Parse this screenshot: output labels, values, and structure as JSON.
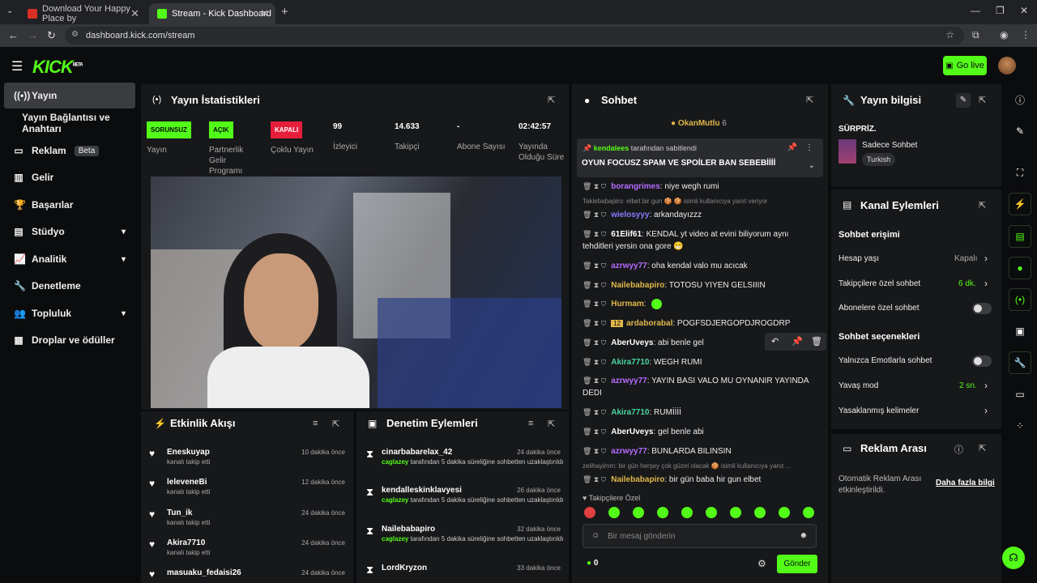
{
  "browser": {
    "tabs": [
      {
        "title": "Download Your Happy Place by"
      },
      {
        "title": "Stream - Kick Dashboard"
      }
    ],
    "url": "dashboard.kick.com/stream"
  },
  "header": {
    "logo": "KICK",
    "logo_sup": "BETA",
    "go_live": "Go live"
  },
  "sidebar": {
    "items": [
      {
        "label": "Yayın"
      },
      {
        "label": "Yayın Bağlantısı ve Anahtarı"
      },
      {
        "label": "Reklam",
        "badge": "Beta"
      },
      {
        "label": "Gelir"
      },
      {
        "label": "Başarılar"
      },
      {
        "label": "Stüdyo"
      },
      {
        "label": "Analitik"
      },
      {
        "label": "Denetleme"
      },
      {
        "label": "Topluluk"
      },
      {
        "label": "Droplar ve ödüller"
      }
    ]
  },
  "stats": {
    "title": "Yayın İstatistikleri",
    "items": [
      {
        "badge": "SORUNSUZ",
        "label": "Yayın"
      },
      {
        "badge": "AÇIK",
        "label": "Partnerlik Gelir Programı"
      },
      {
        "badge": "KAPALI",
        "label": "Çoklu Yayın"
      },
      {
        "value": "99",
        "label": "İzleyici"
      },
      {
        "value": "14.633",
        "label": "Takipçi"
      },
      {
        "value": "-",
        "label": "Abone Sayısı"
      },
      {
        "value": "02:42:57",
        "label": "Yayında Olduğu Süre"
      }
    ]
  },
  "activity": {
    "title": "Etkinlik Akışı",
    "items": [
      {
        "name": "Eneskuyap",
        "sub": "kanalı takip etti",
        "time": "10 dakika önce"
      },
      {
        "name": "leleveneBi",
        "sub": "kanalı takip etti",
        "time": "12 dakika önce"
      },
      {
        "name": "Tun_ik",
        "sub": "kanalı takip etti",
        "time": "24 dakika önce"
      },
      {
        "name": "Akira7710",
        "sub": "kanalı takip etti",
        "time": "24 dakika önce"
      },
      {
        "name": "masuaku_fedaisi26",
        "sub": "",
        "time": "24 dakika önce"
      }
    ]
  },
  "moderation": {
    "title": "Denetim Eylemleri",
    "items": [
      {
        "name": "cinarbabarelax_42",
        "by": "caglazey",
        "desc": "tarafından 5 dakika süreliğine sohbetten uzaklaştırıldı",
        "time": "24 dakika önce"
      },
      {
        "name": "kendalleskinklavyesi",
        "by": "caglazey",
        "desc": "tarafından 5 dakika süreliğine sohbetten uzaklaştırıldı",
        "time": "26 dakika önce"
      },
      {
        "name": "Nailebabapiro",
        "by": "caglazey",
        "desc": "tarafından 5 dakika süreliğine sohbetten uzaklaştırıldı",
        "time": "32 dakika önce"
      },
      {
        "name": "LordKryzon",
        "by": "",
        "desc": "",
        "time": "33 dakika önce"
      }
    ]
  },
  "chat": {
    "title": "Sohbet",
    "top_gifter": "OkanMutlu",
    "top_gifter_count": "6",
    "pinned_by": "kendalees",
    "pinned_suffix": "tarafından sabitlendi",
    "pinned_text": "OYUN FOCUSZ SPAM VE SPOİLER BAN SEBEBİİİİ",
    "messages": [
      {
        "user": "borangrimes",
        "color": "#b56cff",
        "text": ": niye wegh rumi"
      },
      {
        "system": "Takiebabapiro: elbet bir gun 🍪 🍪 isimli kullanıcıya yanıt veriyor"
      },
      {
        "user": "wielosyyy",
        "color": "#8c7bff",
        "text": ": arkandayızzz"
      },
      {
        "user": "61Elif61",
        "color": "#ffffff",
        "text": ": KENDAL yt video at evini biliyorum aynı tehditleri yersin ona gore 😁"
      },
      {
        "user": "azrwyy77",
        "color": "#b56cff",
        "text": ": oha kendal valo mu acıcak"
      },
      {
        "user": "Nailebabapiro",
        "color": "#e0b84a",
        "text": ": TOTOSU YIYEN GELSIIIN"
      },
      {
        "user": "Hurmam",
        "color": "#e0b84a",
        "text": ":"
      },
      {
        "user": "ardaborabal",
        "color": "#e0b84a",
        "text": ": POGFSDJERGOPDJROGDRP",
        "tag": "12"
      },
      {
        "user": "AberUveys",
        "color": "#ffffff",
        "text": ": abi benle gel"
      },
      {
        "user": "Akira7710",
        "color": "#4ad6a2",
        "text": ": WEGH RUMI"
      },
      {
        "user": "azrwyy77",
        "color": "#b56cff",
        "text": ": YAYIN BASI VALO MU OYNANIR YAYINDA DEDI"
      },
      {
        "user": "Akira7710",
        "color": "#4ad6a2",
        "text": ": RUMİİİİ"
      },
      {
        "user": "AberUveys",
        "color": "#ffffff",
        "text": ": gel benle abi"
      },
      {
        "user": "azrwyy77",
        "color": "#b56cff",
        "text": ": BUNLARDA BILINSIN"
      },
      {
        "system": "zelihayimm: bir gün herşey çok güzel olacak 🍪 isimli kullanıcıya yanıt ..."
      },
      {
        "user": "Nailebabapiro",
        "color": "#e0b84a",
        "text": ": bir gün baba hir gun elbet"
      }
    ],
    "followers_only": "Takipçilere Özel",
    "input_placeholder": "Bir mesaj gönderin",
    "points": "0",
    "send": "Gönder"
  },
  "stream_info": {
    "title": "Yayın bilgisi",
    "stream_title": "SÜRPRİZ.",
    "category": "Sadece Sohbet",
    "language": "Turkish"
  },
  "channel_actions": {
    "title": "Kanal Eylemleri",
    "chat_access": "Sohbet erişimi",
    "account_age": "Hesap yaşı",
    "account_age_val": "Kapalı",
    "followers_chat": "Takipçilere özel sohbet",
    "followers_chat_val": "6 dk.",
    "subs_chat": "Abonelere özel sohbet",
    "chat_options": "Sohbet seçenekleri",
    "emote_only": "Yalnızca Emotlarla sohbet",
    "slow_mode": "Yavaş mod",
    "slow_mode_val": "2 sn.",
    "banned_words": "Yasaklanmış kelimeler"
  },
  "ad_break": {
    "title": "Reklam Arası",
    "text": "Otomatik Reklam Arası etkinleştirildi.",
    "link": "Daha fazla bilgi"
  },
  "colors": {
    "accent": "#53fc18",
    "panel": "#17181a",
    "bg": "#0b0c0d"
  }
}
